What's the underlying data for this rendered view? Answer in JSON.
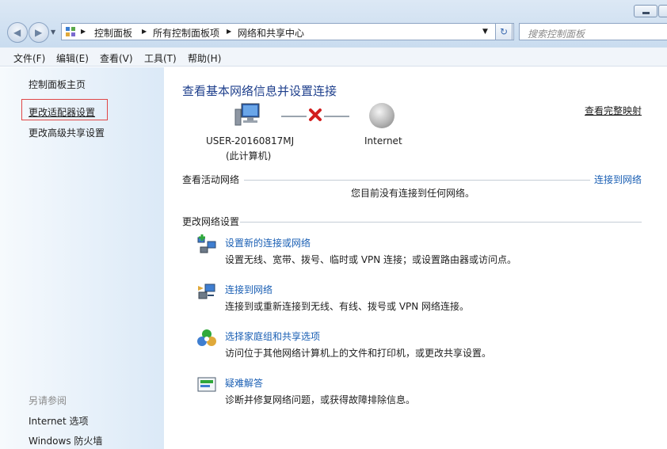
{
  "window": {
    "nav": {
      "back_icon": "back-arrow-icon",
      "forward_icon": "forward-arrow-icon",
      "recent_icon": "chevron-down-icon"
    },
    "address": {
      "icon": "control-panel-icon",
      "segments": [
        "控制面板",
        "所有控制面板项",
        "网络和共享中心"
      ]
    },
    "search": {
      "placeholder": "搜索控制面板"
    }
  },
  "menu": {
    "items": [
      "文件(F)",
      "编辑(E)",
      "查看(V)",
      "工具(T)",
      "帮助(H)"
    ]
  },
  "sidebar": {
    "home": "控制面板主页",
    "adapter_settings": "更改适配器设置",
    "advanced_sharing": "更改高级共享设置",
    "see_also": "另请参阅",
    "links": [
      "Internet 选项",
      "Windows 防火墙"
    ]
  },
  "main": {
    "title": "查看基本网络信息并设置连接",
    "full_map_link": "查看完整映射",
    "map": {
      "computer_name": "USER-20160817MJ",
      "computer_sub": "(此计算机)",
      "internet": "Internet",
      "status_icon": "disconnected-x-icon"
    },
    "active_networks": {
      "heading": "查看活动网络",
      "link": "连接到网络",
      "message": "您目前没有连接到任何网络。"
    },
    "change_settings": {
      "heading": "更改网络设置",
      "tasks": [
        {
          "title": "设置新的连接或网络",
          "desc": "设置无线、宽带、拨号、临时或 VPN 连接；或设置路由器或访问点。",
          "icon": "new-connection-icon"
        },
        {
          "title": "连接到网络",
          "desc": "连接到或重新连接到无线、有线、拨号或 VPN 网络连接。",
          "icon": "connect-network-icon"
        },
        {
          "title": "选择家庭组和共享选项",
          "desc": "访问位于其他网络计算机上的文件和打印机，或更改共享设置。",
          "icon": "homegroup-icon"
        },
        {
          "title": "疑难解答",
          "desc": "诊断并修复网络问题，或获得故障排除信息。",
          "icon": "troubleshoot-icon"
        }
      ]
    }
  },
  "colors": {
    "link": "#1a5fb4",
    "title": "#1e3f8c",
    "error_x": "#d21f1f",
    "highlight_box": "#e04646"
  }
}
